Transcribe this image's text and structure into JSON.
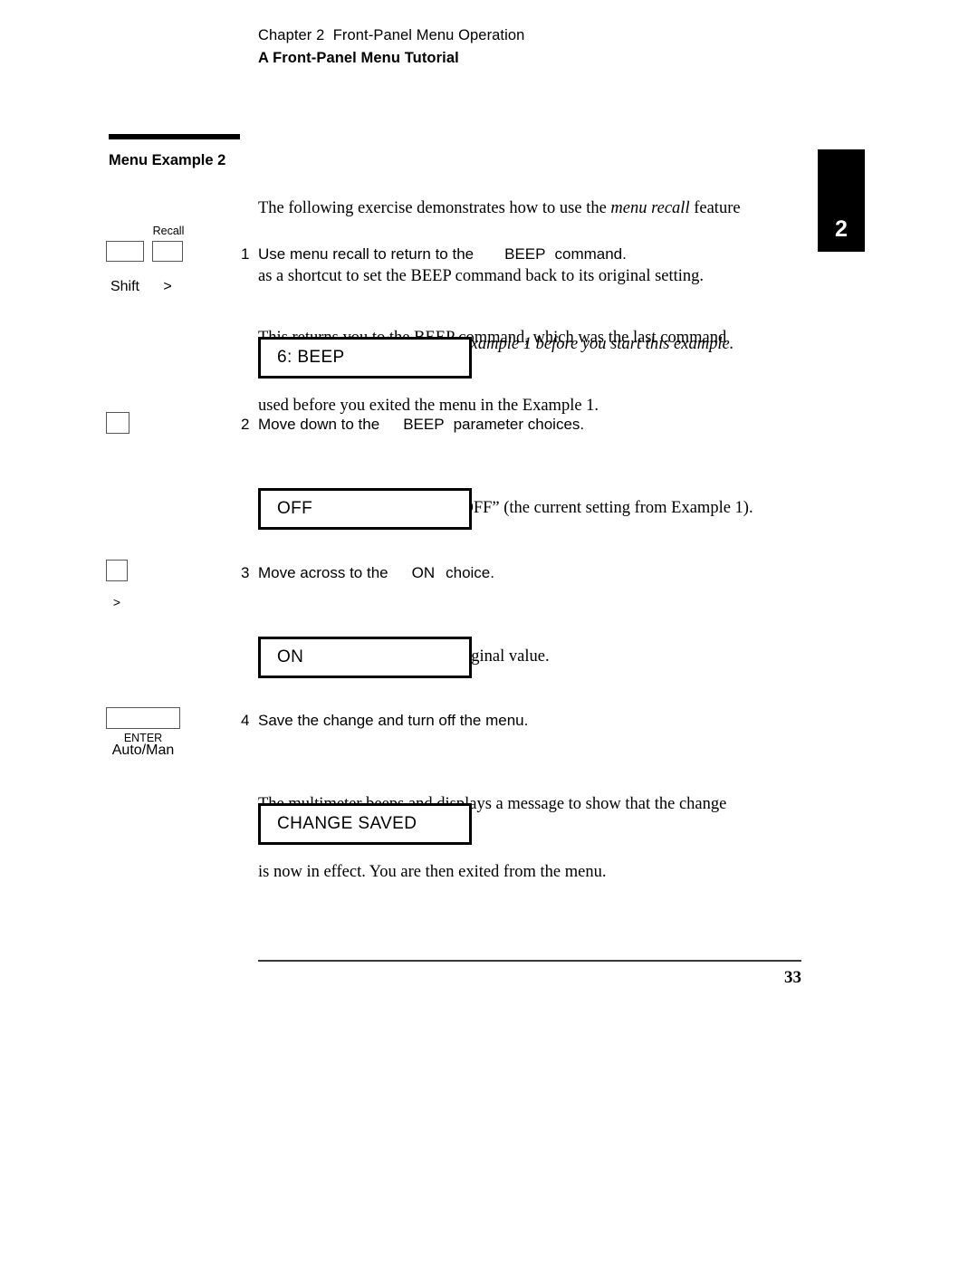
{
  "header": {
    "chapter_line": "Chapter 2  Front-Panel Menu Operation",
    "section_title": "A Front-Panel Menu Tutorial"
  },
  "chapter_tab": {
    "number": "2"
  },
  "sidehead": {
    "label": "Menu Example 2"
  },
  "intro": {
    "line1_a": "The following exercise demonstrates how to use the ",
    "line1_ital": "menu recall",
    "line1_b": " feature",
    "line2": "as a shortcut to set the BEEP command back to its original setting.",
    "line3": "You must perform the steps in Example 1 before you start this example."
  },
  "steps": [
    {
      "number": "1",
      "text_a": "Use menu recall to return to the",
      "mono": "BEEP",
      "text_b": "command.",
      "body_line1": "This returns you to the BEEP command, which was the last command",
      "body_line2": "used before you exited the menu in the Example 1.",
      "display": "6: BEEP",
      "keys": {
        "cap1": "Shift",
        "cap2": ">",
        "above_label": "Recall"
      }
    },
    {
      "number": "2",
      "text_a": "Move down to the",
      "mono": "BEEP",
      "text_b": "parameter choices.",
      "body_line1": "The first parameter choice is “OFF” (the current setting from Example 1).",
      "display": "OFF",
      "keys": {
        "cap1": "",
        "cap_name": "down-arrow-key"
      }
    },
    {
      "number": "3",
      "text_a": "Move across to the",
      "mono": "ON",
      "text_b": "choice.",
      "body_line1": "Set the parameter back to its original value.",
      "display": "ON",
      "keys": {
        "cap1": ">",
        "cap_name": "right-arrow-key"
      }
    },
    {
      "number": "4",
      "text_a": "Save the change and turn off the menu.",
      "mono": "",
      "text_b": "",
      "body_line1": "The multimeter beeps and displays a message to show that the change",
      "body_line2": "is now in effect. You are then exited from the menu.",
      "display": "CHANGE SAVED",
      "keys": {
        "cap1": "Auto/Man",
        "below_label": "ENTER"
      }
    }
  ],
  "footer": {
    "page_number": "33"
  },
  "colors": {
    "ink": "#000000",
    "paper": "#ffffff",
    "rule": "#3a3a3a",
    "keycap_border": "#555555"
  }
}
